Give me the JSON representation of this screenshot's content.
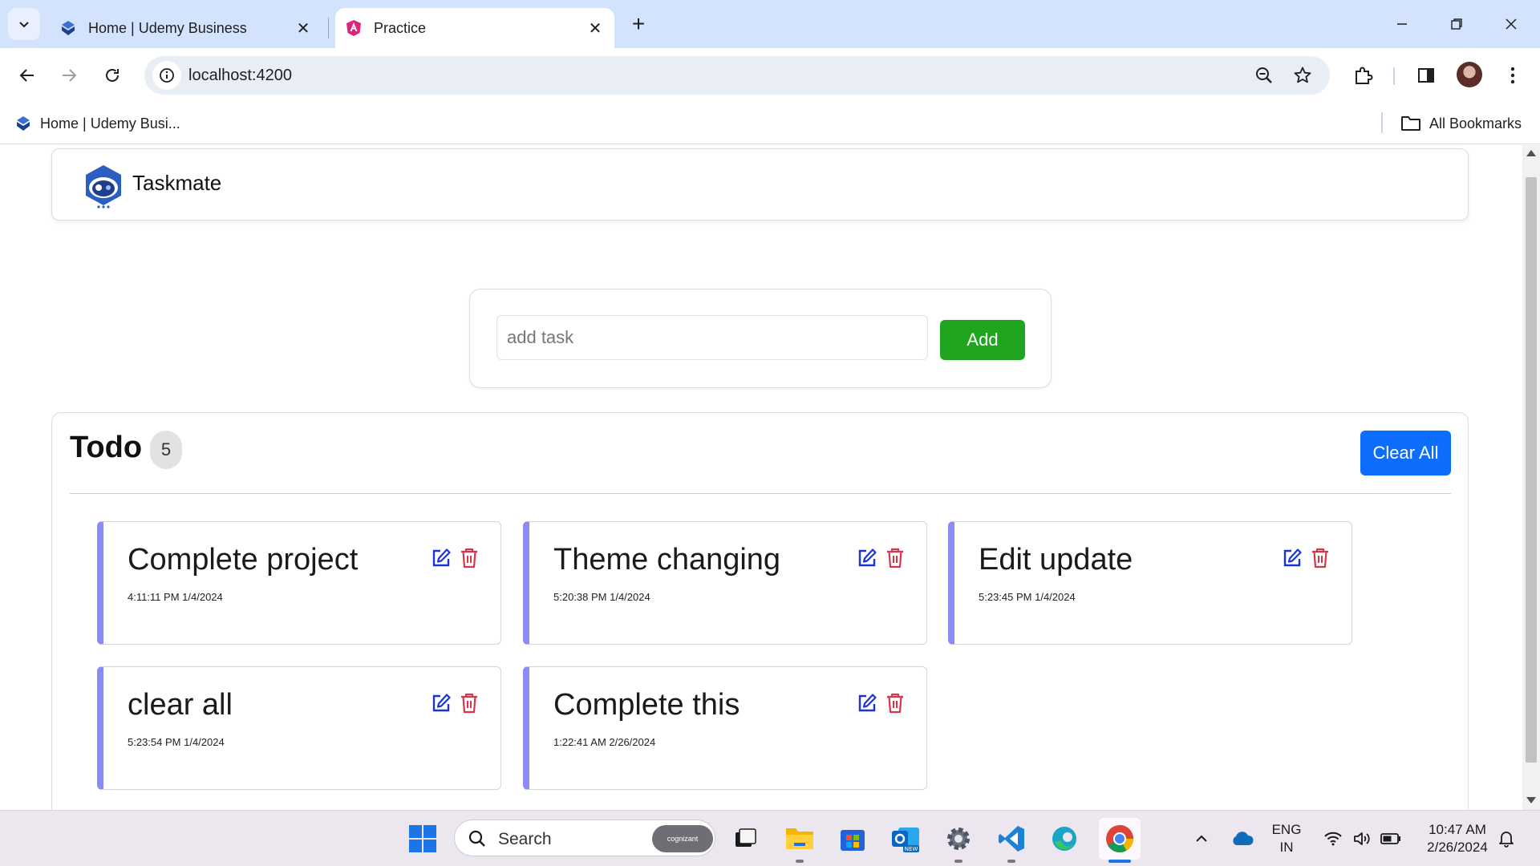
{
  "browser": {
    "tabs": [
      {
        "title": "Home | Udemy Business",
        "active": false
      },
      {
        "title": "Practice",
        "active": true
      }
    ],
    "url": "localhost:4200",
    "bookmarks": {
      "items": [
        {
          "label": "Home | Udemy Busi..."
        }
      ],
      "all_label": "All Bookmarks"
    }
  },
  "app": {
    "brand": "Taskmate",
    "add_form": {
      "placeholder": "add task",
      "value": "",
      "add_label": "Add"
    },
    "todo": {
      "title": "Todo",
      "count": "5",
      "clear_label": "Clear All",
      "tasks": [
        {
          "name": "Complete project",
          "time": "4:11:11 PM 1/4/2024"
        },
        {
          "name": "Theme changing",
          "time": "5:20:38 PM 1/4/2024"
        },
        {
          "name": "Edit update",
          "time": "5:23:45 PM 1/4/2024"
        },
        {
          "name": "clear all",
          "time": "5:23:54 PM 1/4/2024"
        },
        {
          "name": "Complete this",
          "time": "1:22:41 AM 2/26/2024"
        }
      ]
    }
  },
  "taskbar": {
    "search_label": "Search",
    "search_badge": "cognizant",
    "lang_line1": "ENG",
    "lang_line2": "IN",
    "time": "10:47 AM",
    "date": "2/26/2024"
  },
  "colors": {
    "add_button": "#1fa51f",
    "clear_button": "#0d6efd",
    "task_accent": "#8b8bf5",
    "edit_icon": "#1a35d6",
    "delete_icon": "#d6354a",
    "tabstrip": "#d3e3fd"
  }
}
